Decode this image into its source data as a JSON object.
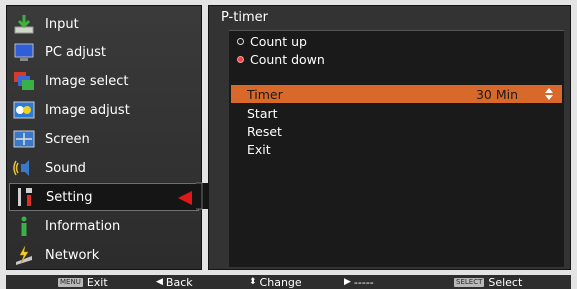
{
  "menu": {
    "items": [
      {
        "label": "Input",
        "icon": "input-icon"
      },
      {
        "label": "PC adjust",
        "icon": "pc-adjust-icon"
      },
      {
        "label": "Image select",
        "icon": "image-select-icon"
      },
      {
        "label": "Image adjust",
        "icon": "image-adjust-icon"
      },
      {
        "label": "Screen",
        "icon": "screen-icon"
      },
      {
        "label": "Sound",
        "icon": "sound-icon"
      },
      {
        "label": "Setting",
        "icon": "setting-icon",
        "selected": true
      },
      {
        "label": "Information",
        "icon": "information-icon"
      },
      {
        "label": "Network",
        "icon": "network-icon"
      }
    ]
  },
  "panel": {
    "title": "P-timer",
    "mode_options": [
      {
        "label": "Count up",
        "selected": false
      },
      {
        "label": "Count down",
        "selected": true
      }
    ],
    "options": [
      {
        "label": "Timer",
        "value": "30  Min",
        "highlighted": true
      },
      {
        "label": "Start"
      },
      {
        "label": "Reset"
      },
      {
        "label": "Exit"
      }
    ]
  },
  "footer": {
    "menu_key": "MENU",
    "exit_label": "Exit",
    "back_label": "Back",
    "change_label": "Change",
    "next_label": "-----",
    "select_key": "SELECT",
    "select_label": "Select"
  },
  "colors": {
    "highlight": "#d8692a",
    "selection_arrow": "#e01818",
    "menu_bg": "#333333"
  }
}
